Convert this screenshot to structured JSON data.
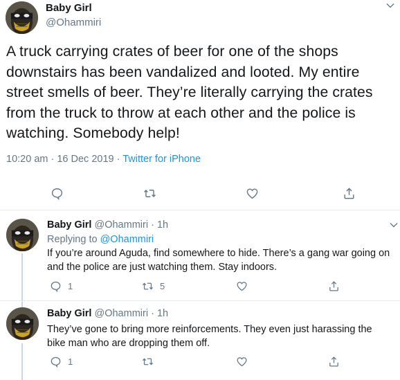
{
  "main_tweet": {
    "name": "Baby Girl",
    "handle": "@Ohammiri",
    "text": "A truck carrying crates of beer for one of the shops downstairs has been vandalized and looted. My entire street smells of beer. They’re literally carrying the crates from the truck to throw at each other and the police is watching. Somebody help!",
    "time": "10:20 am · 16 Dec 2019 · ",
    "source": "Twitter for iPhone",
    "actions": {
      "reply_icon": "comment-icon",
      "retweet_icon": "retweet-icon",
      "like_icon": "heart-icon",
      "share_icon": "share-icon"
    }
  },
  "replies": [
    {
      "name": "Baby Girl",
      "handle_time": "@Ohammiri · 1h",
      "replying_prefix": "Replying to ",
      "replying_to": "@Ohammiri",
      "text": "If you’re around Aguda, find somewhere to hide. There’s a gang war going on and the police are just watching them. Stay indoors.",
      "reply_count": "1",
      "retweet_count": "5",
      "like_count": ""
    },
    {
      "name": "Baby Girl",
      "handle_time": "@Ohammiri · 1h",
      "text": "They’ve gone to bring more reinforcements. They even just harassing the bike man who are dropping them off.",
      "reply_count": "1",
      "retweet_count": "",
      "like_count": ""
    }
  ],
  "colors": {
    "accent": "#1b95e0",
    "muted": "#657786",
    "text": "#14171a",
    "divider": "#e6ecf0"
  }
}
